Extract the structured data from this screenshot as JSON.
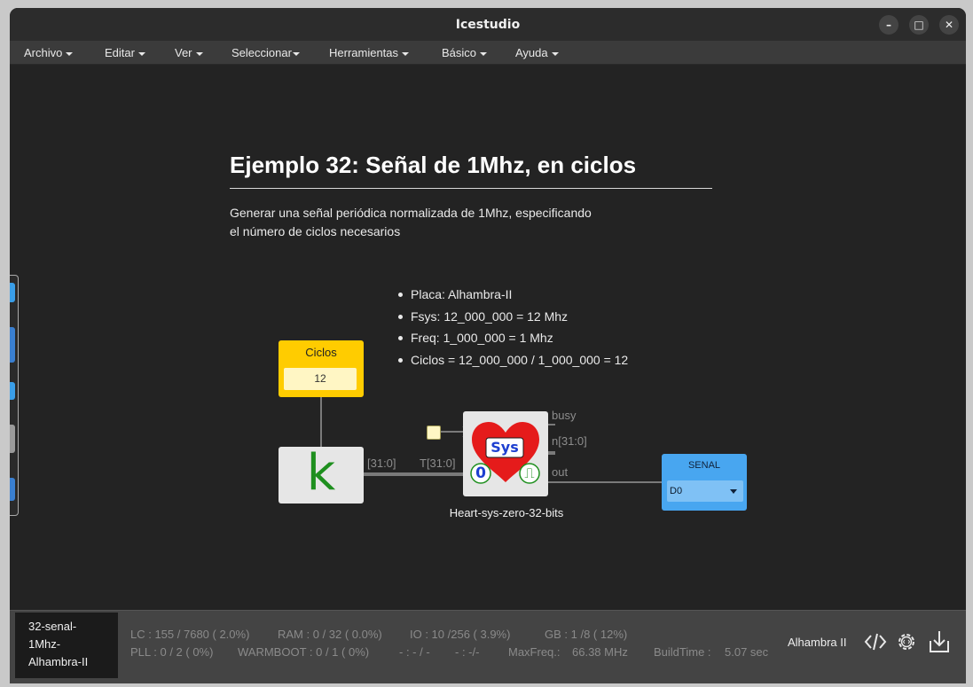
{
  "window": {
    "title": "Icestudio",
    "minimize_glyph": "–",
    "maximize_glyph": "□",
    "close_glyph": "✕"
  },
  "menu": {
    "items": [
      "Archivo",
      "Editar",
      "Ver",
      "Seleccionar",
      "Herramientas",
      "Básico",
      "Ayuda"
    ]
  },
  "canvas": {
    "title": "Ejemplo 32: Señal de 1Mhz, en ciclos",
    "description_lines": [
      "Generar una señal periódica normalizada de 1Mhz, especificando",
      "el número de ciclos necesarios"
    ],
    "bullets": [
      "Placa: Alhambra-II",
      "Fsys: 12_000_000 = 12 Mhz",
      "Freq: 1_000_000 = 1 Mhz",
      "Ciclos = 12_000_000 / 1_000_000 = 12"
    ],
    "const_block": {
      "name": "Ciclos",
      "value": "12"
    },
    "k_block": {
      "glyph": "k"
    },
    "wire_labels": {
      "k_out": "[31:0]",
      "heart_in": "T[31:0]"
    },
    "heart_block": {
      "label": "Sys",
      "zero_glyph": "0",
      "pulse_glyph": "⎍",
      "caption": "Heart-sys-zero-32-bits",
      "ports": {
        "busy": "busy",
        "n": "n[31:0]",
        "out": "out"
      }
    },
    "output_block": {
      "name": "SENAL",
      "pin": "D0"
    }
  },
  "status": {
    "project_name_lines": [
      "32-senal-",
      "1Mhz-",
      "Alhambra-II"
    ],
    "lc": "LC : 155 / 7680 ( 2.0%)",
    "ram": "RAM : 0 / 32 ( 0.0%)",
    "io": "IO :  10 /256  ( 3.9%)",
    "gb": "GB :  1 /8  ( 12%)",
    "pll": "PLL : 0 / 2 ( 0%)",
    "warmboot": "WARMBOOT : 0 / 1 ( 0%)",
    "dash1": "- : - / -",
    "dash2": "- :  -/-",
    "maxfreq_label": "MaxFreq.:",
    "maxfreq_value": "66.38 MHz",
    "buildtime_label": "BuildTime :",
    "buildtime_value": "5.07 sec",
    "board": "Alhambra II",
    "icons": [
      "code-icon",
      "settings-gear-icon",
      "download-icon"
    ]
  },
  "colors": {
    "const_block": "#ffcc00",
    "output_block": "#48a6f0",
    "heart": "#e51b1b",
    "k_glyph": "#1e8f1e"
  }
}
